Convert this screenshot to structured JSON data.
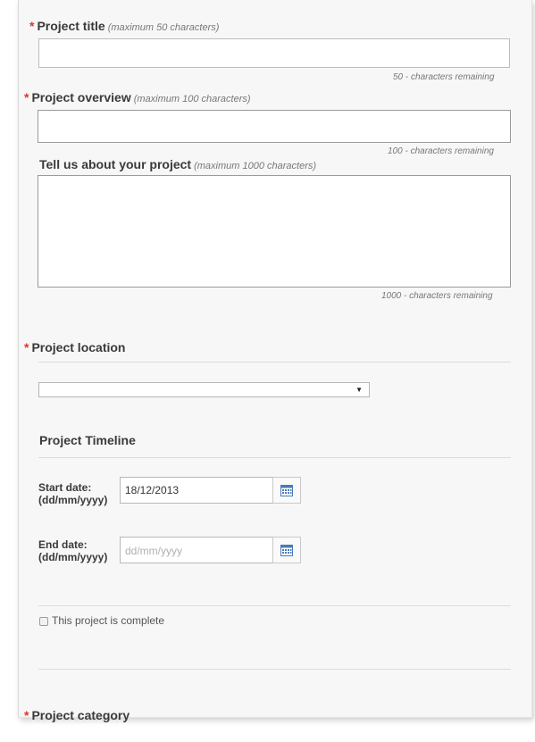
{
  "form": {
    "project_title": {
      "required_mark": "*",
      "label": "Project title",
      "hint": "(maximum 50 characters)",
      "value": "",
      "counter": "50 - characters remaining"
    },
    "project_overview": {
      "required_mark": "*",
      "label": "Project overview",
      "hint": "(maximum 100 characters)",
      "value": "",
      "counter": "100 - characters remaining"
    },
    "project_description": {
      "label": "Tell us about your project",
      "hint": "(maximum 1000 characters)",
      "value": "",
      "counter": "1000 - characters remaining"
    },
    "project_location": {
      "required_mark": "*",
      "label": "Project location",
      "selected_value": "",
      "arrow": "▼"
    },
    "timeline": {
      "title": "Project Timeline",
      "start_date": {
        "label_line1": "Start date:",
        "label_line2": "(dd/mm/yyyy)",
        "value": "18/12/2013"
      },
      "end_date": {
        "label_line1": "End date:",
        "label_line2": "(dd/mm/yyyy)",
        "placeholder": "dd/mm/yyyy"
      },
      "calendar_icon": "calendar-icon"
    },
    "complete_checkbox": {
      "label": "This project is complete",
      "checked": false
    },
    "project_category": {
      "required_mark": "*",
      "label": "Project category"
    }
  },
  "colors": {
    "required": "#d9362b",
    "calendar": "#4a7bb7"
  }
}
